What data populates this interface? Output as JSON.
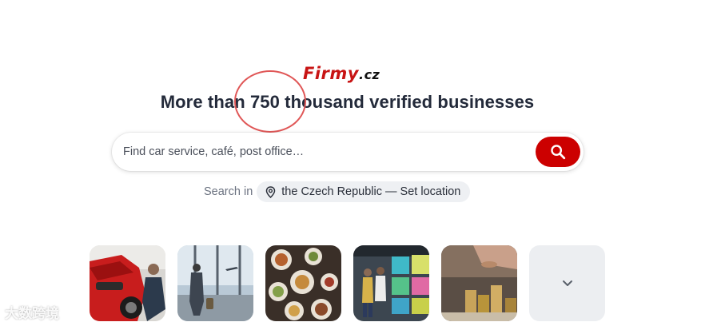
{
  "brand": {
    "logo_text": "Firmy",
    "logo_suffix": ".cz",
    "color": "#cc0000"
  },
  "hero": {
    "headline": "More than 750 thousand verified businesses",
    "highlight_color": "#e05757"
  },
  "search": {
    "placeholder": "Find car service, café, post office…",
    "value": "",
    "button_icon": "search-icon",
    "button_color": "#cc0000"
  },
  "location": {
    "label": "Search in",
    "icon": "map-pin-icon",
    "value": "the Czech Republic — Set location"
  },
  "categories": {
    "tiles": [
      {
        "icon": "car-service-photo"
      },
      {
        "icon": "airport-travel-photo"
      },
      {
        "icon": "food-restaurant-photo"
      },
      {
        "icon": "electronics-store-photo"
      },
      {
        "icon": "finance-coins-photo"
      }
    ],
    "more_icon": "chevron-down-icon"
  },
  "watermark": {
    "text": "大数跨境"
  }
}
